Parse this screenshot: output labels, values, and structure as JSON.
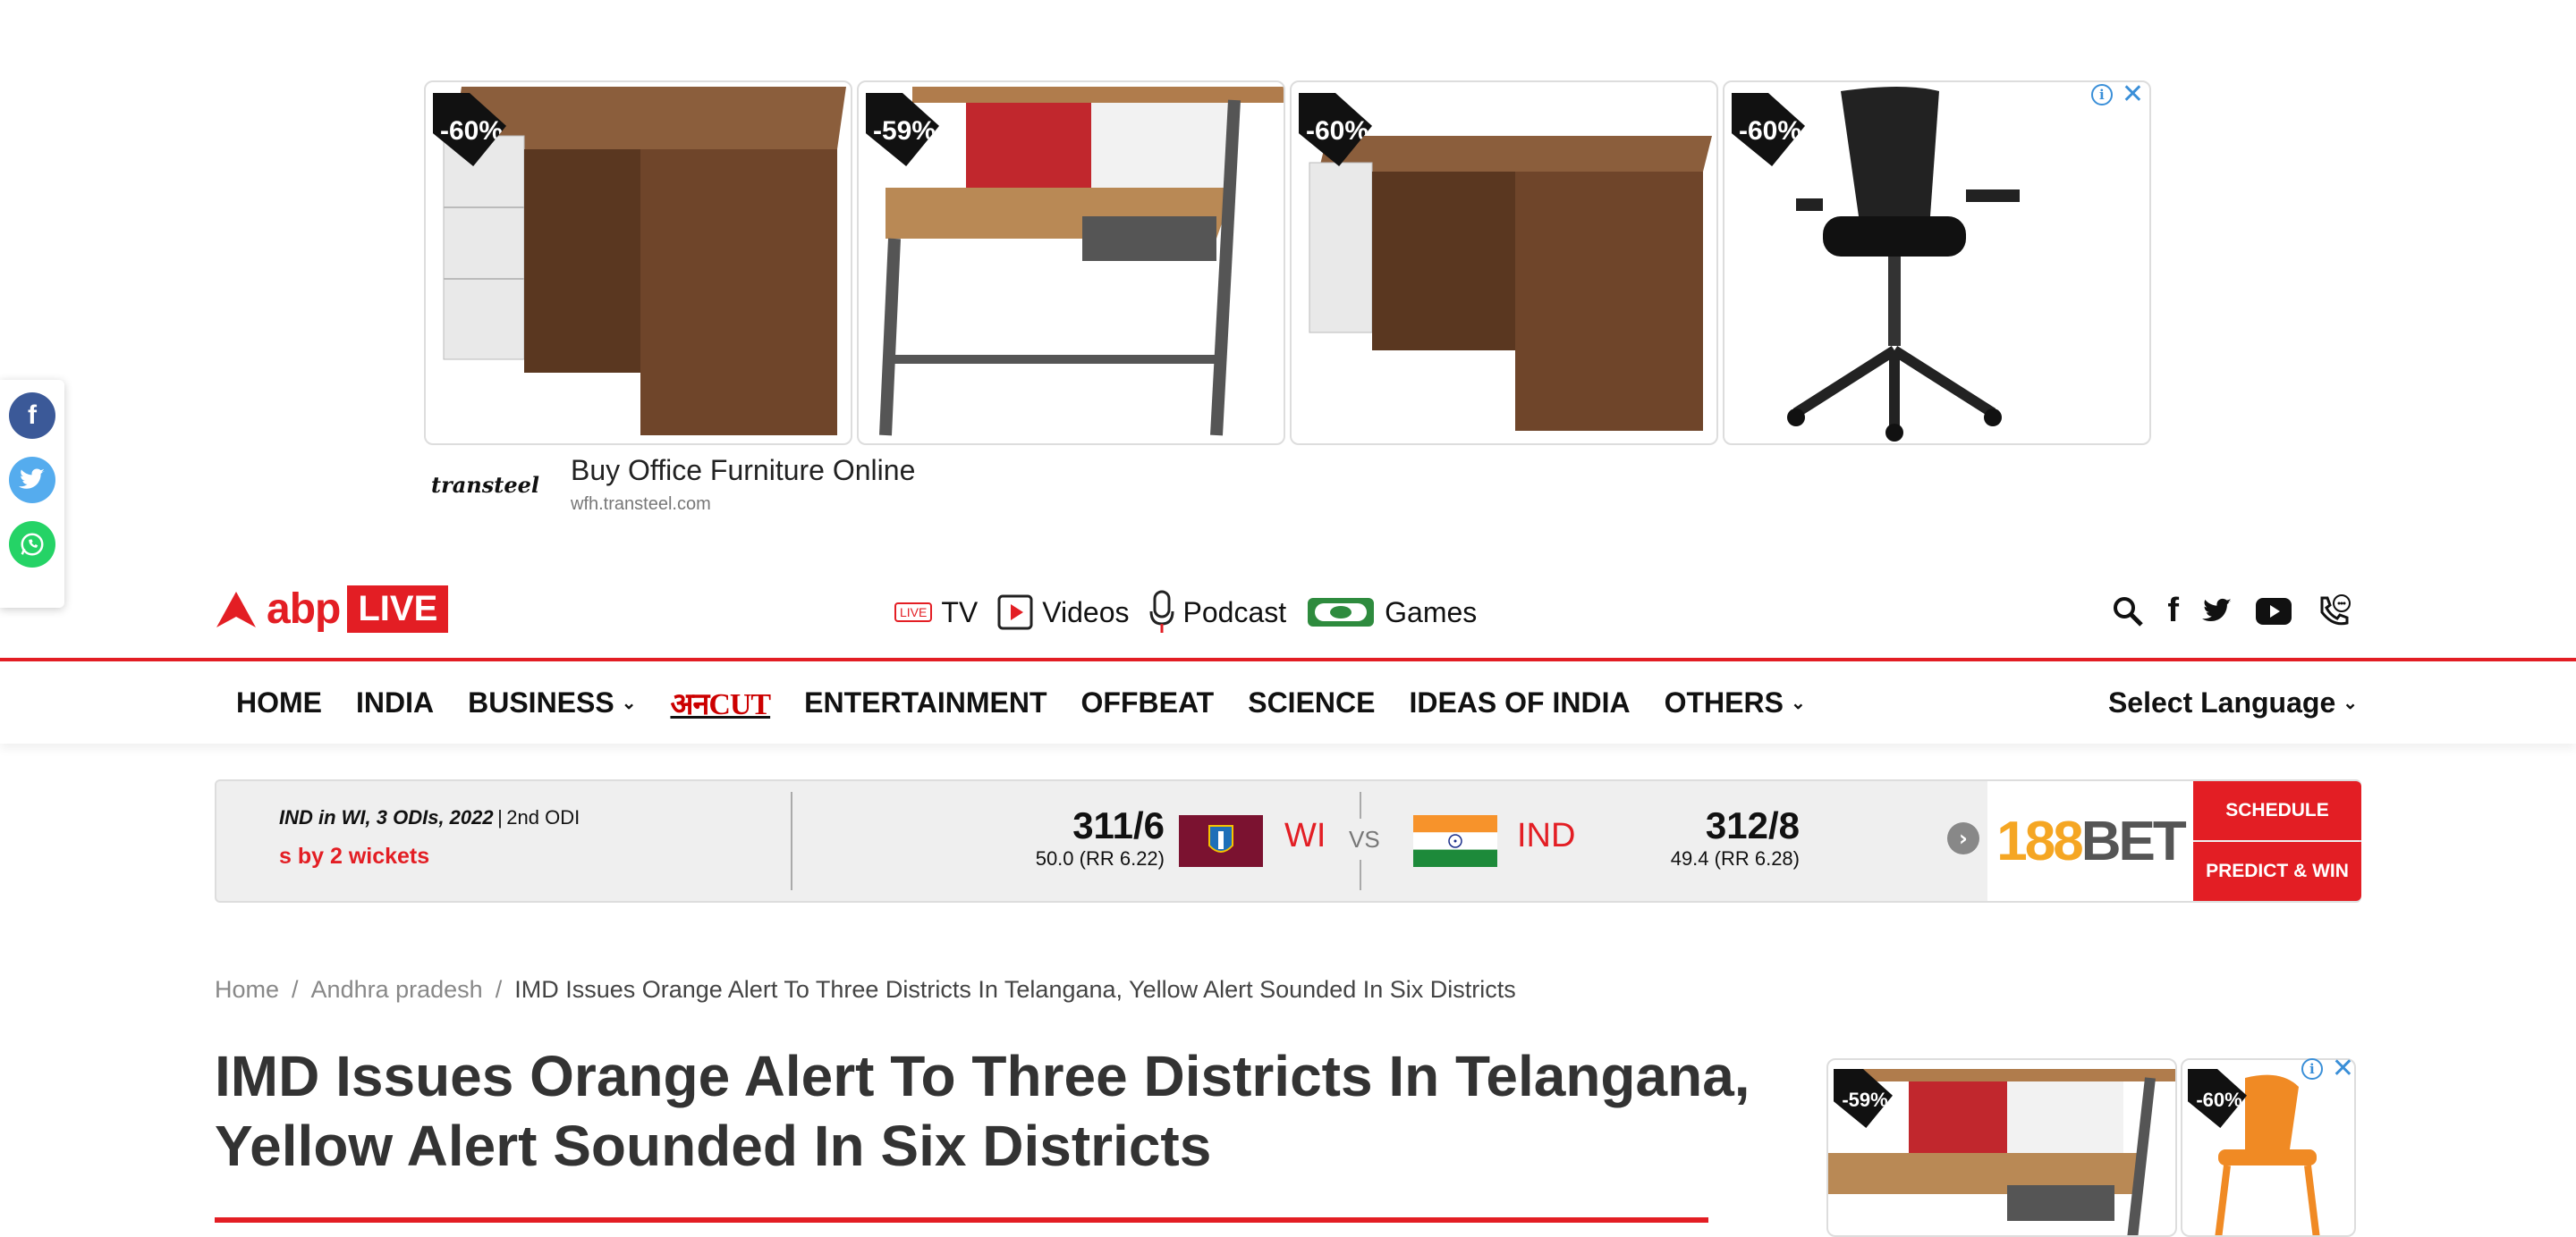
{
  "ad_top": {
    "tiles": [
      {
        "discount": "-60%",
        "product": "office-desk-drawers"
      },
      {
        "discount": "-59%",
        "product": "study-desk-shelf"
      },
      {
        "discount": "-60%",
        "product": "office-desk-drawers"
      },
      {
        "discount": "-60%",
        "product": "mesh-office-chair"
      }
    ],
    "brand": "transteel",
    "title": "Buy Office Furniture Online",
    "url": "wfh.transteel.com",
    "info_icon": "info-icon",
    "close_icon": "close-icon"
  },
  "share": [
    {
      "network": "facebook",
      "icon": "facebook-icon",
      "color": "#3b5998"
    },
    {
      "network": "twitter",
      "icon": "twitter-icon",
      "color": "#55acee"
    },
    {
      "network": "whatsapp",
      "icon": "whatsapp-icon",
      "color": "#25d366"
    }
  ],
  "header": {
    "logo_text": "abp",
    "logo_badge": "LIVE",
    "tv_badge": "LIVE",
    "hub": [
      {
        "label": "TV",
        "icon": "tv-icon"
      },
      {
        "label": "Videos",
        "icon": "play-icon"
      },
      {
        "label": "Podcast",
        "icon": "microphone-icon"
      },
      {
        "label": "Games",
        "icon": "games-icon"
      }
    ],
    "icons": [
      "search-icon",
      "facebook-icon",
      "twitter-icon",
      "youtube-icon",
      "phone-icon"
    ],
    "brand_color": "#e31e24"
  },
  "nav": {
    "items": [
      "HOME",
      "INDIA",
      "BUSINESS",
      "अनCUT",
      "ENTERTAINMENT",
      "OFFBEAT",
      "SCIENCE",
      "IDEAS OF INDIA",
      "OTHERS"
    ],
    "select_language": "Select Language"
  },
  "score": {
    "series": "IND in WI, 3 ODIs, 2022",
    "separator": "|",
    "match": "2nd ODI",
    "status": "s by 2 wickets",
    "team1": {
      "name": "WI",
      "runs": "311/6",
      "overs": "50.0 (RR 6.22)"
    },
    "vs": "VS",
    "team2": {
      "name": "IND",
      "runs": "312/8",
      "overs": "49.4 (RR 6.28)"
    },
    "sponsor": "188BET",
    "schedule": "SCHEDULE",
    "predict": "PREDICT & WIN"
  },
  "breadcrumb": {
    "home": "Home",
    "section": "Andhra pradesh",
    "sep": "/",
    "current": "IMD Issues Orange Alert To Three Districts In Telangana, Yellow Alert Sounded In Six Districts"
  },
  "article": {
    "title": "IMD Issues Orange Alert To Three Districts In Telangana, Yellow Alert Sounded In Six Districts"
  },
  "ad_side": {
    "tiles": [
      {
        "discount": "-59%",
        "product": "study-desk-shelf"
      },
      {
        "discount": "-60%",
        "product": "orange-chair"
      }
    ]
  }
}
